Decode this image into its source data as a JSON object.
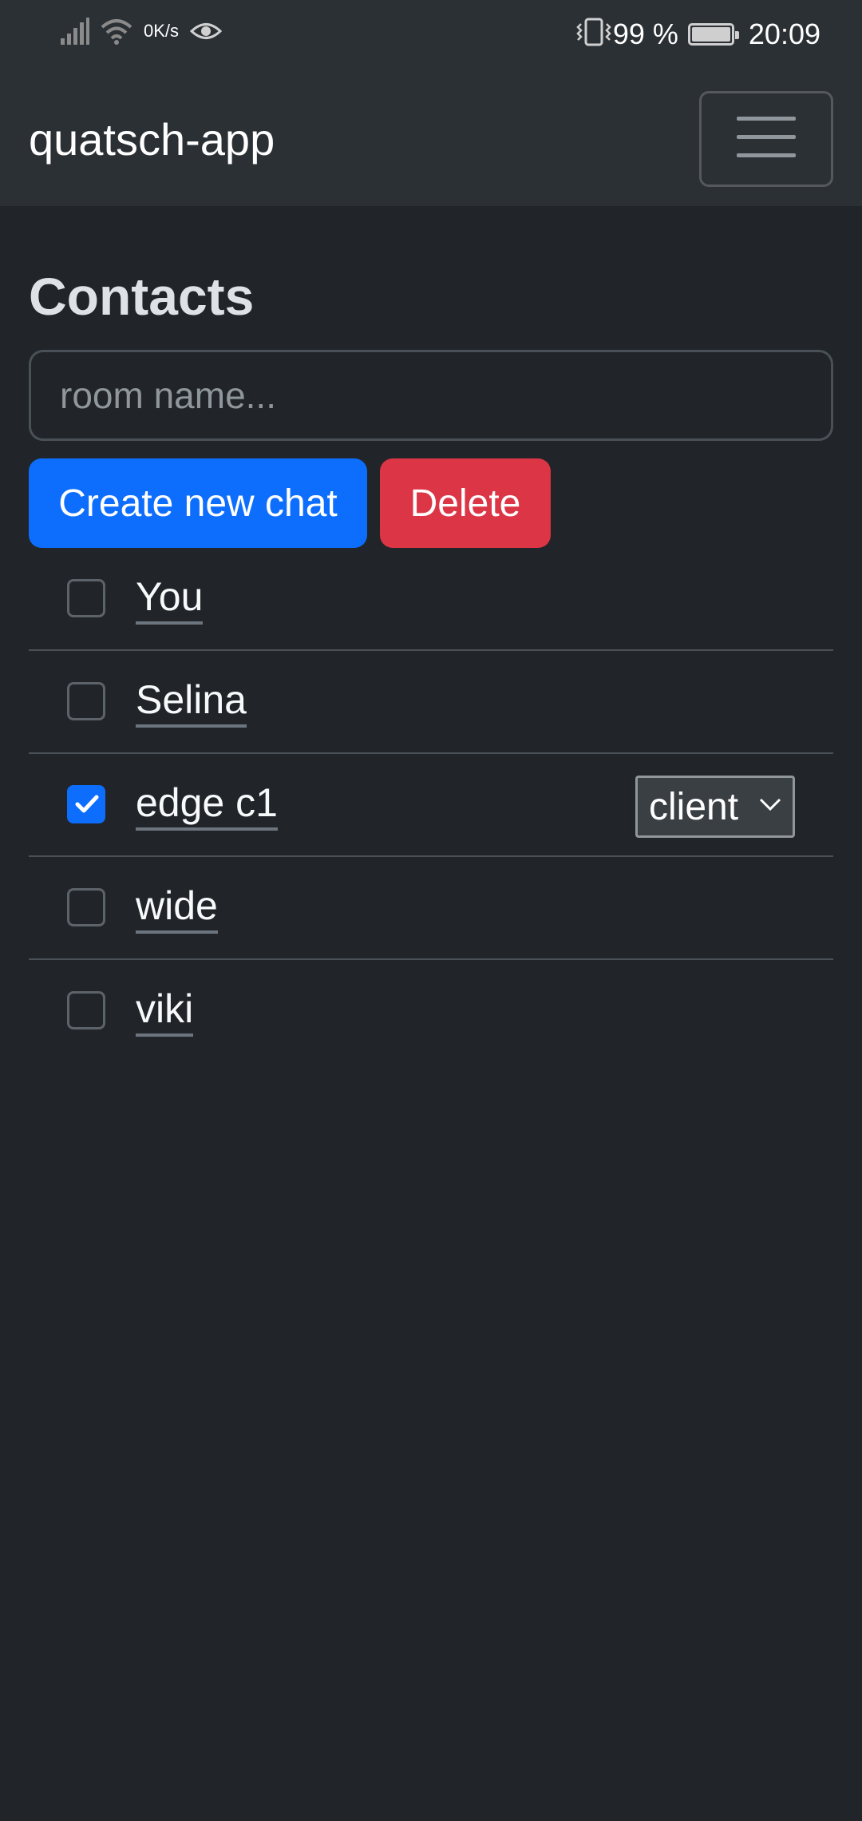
{
  "status_bar": {
    "net_speed_value": "0",
    "net_speed_unit": "K/s",
    "battery_percent": "99 %",
    "time": "20:09"
  },
  "navbar": {
    "brand": "quatsch-app"
  },
  "page": {
    "title": "Contacts",
    "room_input_placeholder": "room name...",
    "room_input_value": "",
    "create_button": "Create new chat",
    "delete_button": "Delete"
  },
  "contacts": [
    {
      "name": "You",
      "checked": false
    },
    {
      "name": "Selina",
      "checked": false
    },
    {
      "name": "edge c1",
      "checked": true,
      "role": "client"
    },
    {
      "name": "wide",
      "checked": false
    },
    {
      "name": "viki",
      "checked": false
    }
  ],
  "colors": {
    "background": "#212529",
    "navbar": "#2b3035",
    "primary": "#0d6efd",
    "danger": "#dc3545"
  }
}
